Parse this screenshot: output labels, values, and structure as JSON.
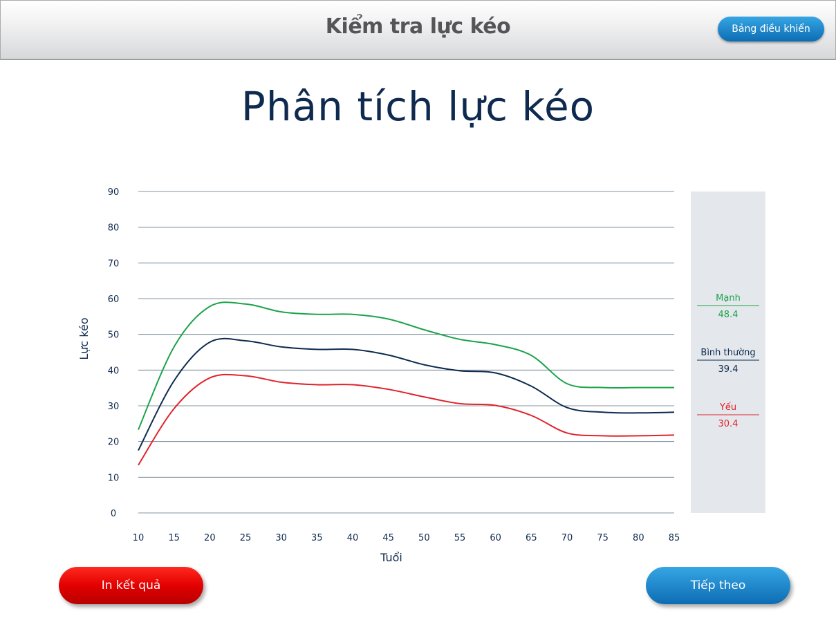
{
  "header": {
    "title": "Kiểm tra lực kéo",
    "dashboard_button": "Bảng điều khiển"
  },
  "page_title": "Phân tích lực kéo",
  "buttons": {
    "print": "In kết quả",
    "next": "Tiếp theo"
  },
  "colors": {
    "strong": "#1aa34a",
    "normal": "#0d2b4f",
    "weak": "#e0232b",
    "legend_bg": "#e4e8ec",
    "grid": "#5b7083"
  },
  "chart_data": {
    "type": "line",
    "xlabel": "Tuổi",
    "ylabel": "Lực kéo",
    "xlim": [
      10,
      85
    ],
    "ylim": [
      0,
      90
    ],
    "xticks": [
      10,
      15,
      20,
      25,
      30,
      35,
      40,
      45,
      50,
      55,
      60,
      65,
      70,
      75,
      80,
      85
    ],
    "yticks": [
      0,
      10,
      20,
      30,
      40,
      50,
      60,
      70,
      80,
      90
    ],
    "grid": true,
    "legend_position": "right",
    "series": [
      {
        "name": "Mạnh",
        "value_label": "48.4",
        "color": "#1aa34a",
        "x": [
          10,
          15,
          20,
          25,
          30,
          35,
          40,
          45,
          50,
          55,
          60,
          65,
          70,
          75,
          80,
          85
        ],
        "y": [
          23.3,
          46.5,
          57.8,
          58.5,
          56.3,
          55.6,
          55.6,
          54.3,
          51.3,
          48.6,
          47.1,
          44.1,
          36.2,
          35.1,
          35.1,
          35.1
        ]
      },
      {
        "name": "Bình thường",
        "value_label": "39.4",
        "color": "#0d2b4f",
        "x": [
          10,
          15,
          20,
          25,
          30,
          35,
          40,
          45,
          50,
          55,
          60,
          65,
          70,
          75,
          80,
          85
        ],
        "y": [
          17.5,
          37.0,
          47.8,
          48.2,
          46.5,
          45.8,
          45.8,
          44.2,
          41.5,
          39.8,
          39.2,
          35.5,
          29.5,
          28.2,
          28.0,
          28.2
        ]
      },
      {
        "name": "Yếu",
        "value_label": "30.4",
        "color": "#e0232b",
        "x": [
          10,
          15,
          20,
          25,
          30,
          35,
          40,
          45,
          50,
          55,
          60,
          65,
          70,
          75,
          80,
          85
        ],
        "y": [
          13.4,
          29.2,
          37.8,
          38.4,
          36.6,
          35.9,
          35.9,
          34.6,
          32.5,
          30.6,
          30.1,
          27.3,
          22.4,
          21.6,
          21.6,
          21.8
        ]
      }
    ]
  }
}
